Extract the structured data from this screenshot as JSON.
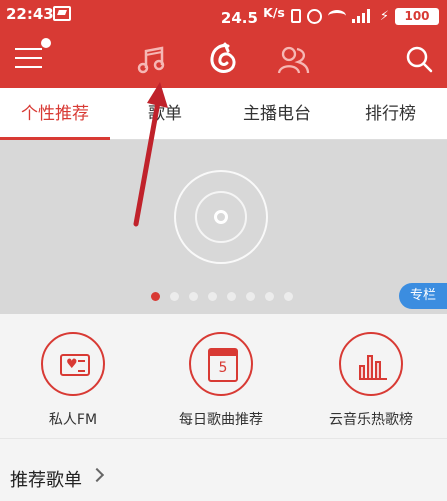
{
  "status_bar": {
    "time": "22:43",
    "network_speed": "24.5",
    "network_speed_unit": "K/s",
    "battery": "100"
  },
  "app_bar": {
    "icons": [
      "menu-icon",
      "music-icon",
      "netease-music-icon",
      "friends-icon",
      "search-icon"
    ],
    "accent_color": "#d83a34"
  },
  "tabs": [
    {
      "label": "个性推荐",
      "active": true
    },
    {
      "label": "歌单",
      "active": false
    },
    {
      "label": "主播电台",
      "active": false
    },
    {
      "label": "排行榜",
      "active": false
    }
  ],
  "banner": {
    "badge": "专栏",
    "dots_total": 8,
    "active_dot": 0
  },
  "shortcuts": [
    {
      "label": "私人FM",
      "icon": "radio-icon"
    },
    {
      "label": "每日歌曲推荐",
      "icon": "calendar-icon",
      "day": "5"
    },
    {
      "label": "云音乐热歌榜",
      "icon": "chart-icon"
    }
  ],
  "recommend_section": {
    "title": "推荐歌单"
  }
}
